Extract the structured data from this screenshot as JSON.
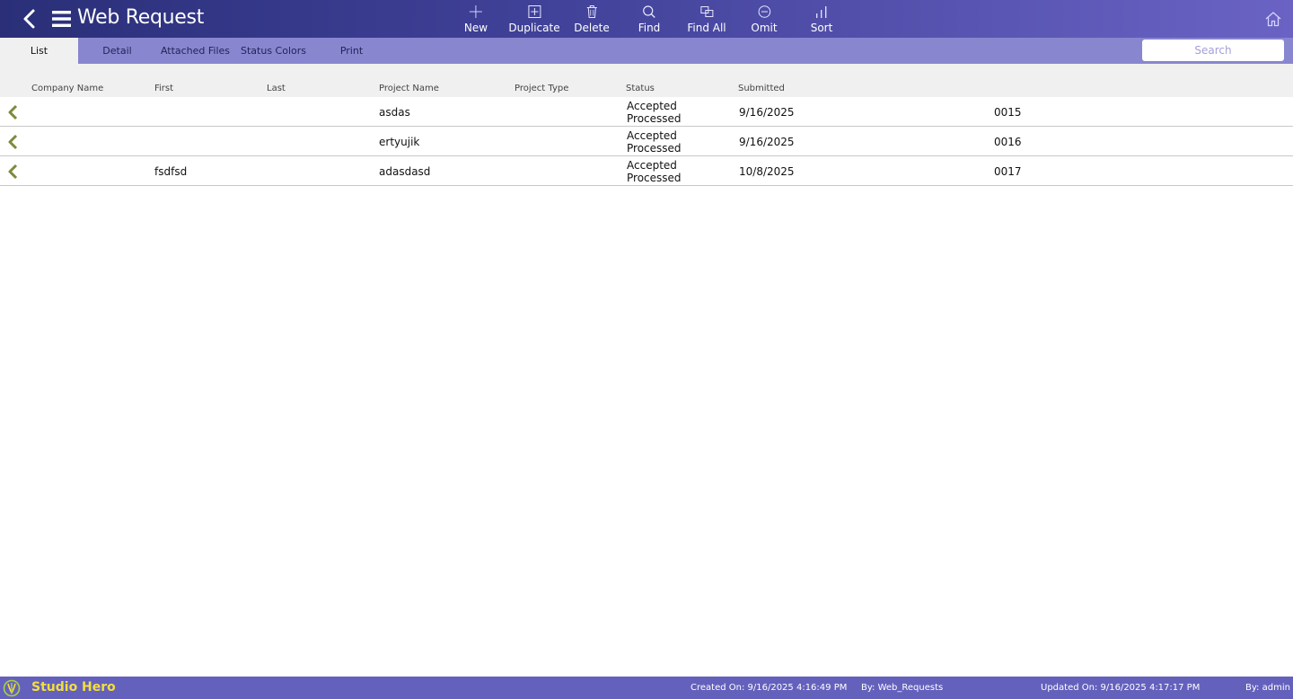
{
  "header": {
    "title": "Web Request",
    "toolbar": [
      {
        "id": "new",
        "label": "New",
        "icon": "plus-icon"
      },
      {
        "id": "duplicate",
        "label": "Duplicate",
        "icon": "duplicate-icon"
      },
      {
        "id": "delete",
        "label": "Delete",
        "icon": "trash-icon"
      },
      {
        "id": "find",
        "label": "Find",
        "icon": "magnifier-icon"
      },
      {
        "id": "find_all",
        "label": "Find All",
        "icon": "find-all-icon"
      },
      {
        "id": "omit",
        "label": "Omit",
        "icon": "omit-icon"
      },
      {
        "id": "sort",
        "label": "Sort",
        "icon": "sort-icon"
      }
    ]
  },
  "tabs": [
    {
      "label": "List",
      "active": true
    },
    {
      "label": "Detail",
      "active": false
    },
    {
      "label": "Attached Files",
      "active": false
    },
    {
      "label": "Status Colors",
      "active": false
    },
    {
      "label": "Print",
      "active": false
    }
  ],
  "search": {
    "placeholder": "Search",
    "value": ""
  },
  "columns": [
    "Company Name",
    "First",
    "Last",
    "Project Name",
    "Project Type",
    "Status",
    "Submitted"
  ],
  "rows": [
    {
      "company": "",
      "first": "",
      "last": "",
      "project_name": "asdas",
      "project_type": "",
      "status_line1": "Accepted",
      "status_line2": "Processed",
      "submitted": "9/16/2025",
      "id": "0015"
    },
    {
      "company": "",
      "first": "",
      "last": "",
      "project_name": "ertyujik",
      "project_type": "",
      "status_line1": "Accepted",
      "status_line2": "Processed",
      "submitted": "9/16/2025",
      "id": "0016"
    },
    {
      "company": "",
      "first": "fsdfsd",
      "last": "",
      "project_name": "adasdasd",
      "project_type": "",
      "status_line1": "Accepted",
      "status_line2": "Processed",
      "submitted": "10/8/2025",
      "id": "0017"
    }
  ],
  "footer": {
    "brand": "Studio Hero",
    "created": "Created On: 9/16/2025 4:16:49 PM",
    "created_by": "By: Web_Requests",
    "updated": "Updated On: 9/16/2025 4:17:17 PM",
    "updated_by": "By: admin"
  },
  "colors": {
    "header_start": "#2a2f78",
    "header_end": "#6a63c4",
    "tab_strip": "#8886cf",
    "footer": "#6461bd",
    "brand_text": "#f3df3c",
    "row_arrow": "#7d8a3c"
  }
}
